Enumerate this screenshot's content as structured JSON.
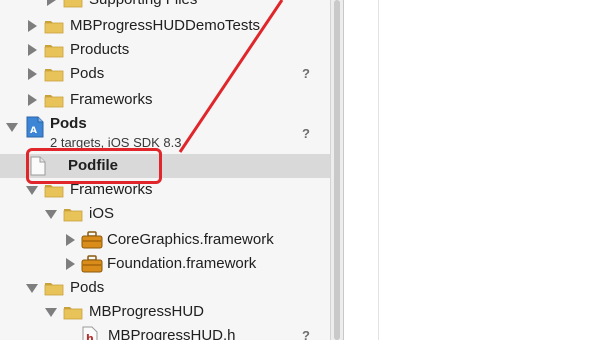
{
  "navigator": {
    "rows": [
      {
        "label": "Supporting Files",
        "icon": "folder-icon",
        "disclosure": "right",
        "indent": 1,
        "status": ""
      },
      {
        "label": "MBProgressHUDDemoTests",
        "icon": "folder-icon",
        "disclosure": "right",
        "indent": 0,
        "status": ""
      },
      {
        "label": "Products",
        "icon": "folder-icon",
        "disclosure": "right",
        "indent": 0,
        "status": ""
      },
      {
        "label": "Pods",
        "icon": "folder-icon",
        "disclosure": "right",
        "indent": 0,
        "status": "?"
      },
      {
        "label": "Frameworks",
        "icon": "folder-icon",
        "disclosure": "right",
        "indent": 0,
        "status": ""
      },
      {
        "label": "Pods",
        "sublabel": "2 targets, iOS SDK 8.3",
        "icon": "xcode-project-icon",
        "disclosure": "down",
        "indent": -1,
        "status": "?"
      },
      {
        "label": "Podfile",
        "icon": "file-icon",
        "disclosure": "none",
        "indent": 0,
        "status": "",
        "selected": true
      },
      {
        "label": "Frameworks",
        "icon": "folder-icon",
        "disclosure": "down",
        "indent": 0,
        "status": ""
      },
      {
        "label": "iOS",
        "icon": "folder-icon",
        "disclosure": "down",
        "indent": 1,
        "status": ""
      },
      {
        "label": "CoreGraphics.framework",
        "icon": "framework-toolbox-icon",
        "disclosure": "right",
        "indent": 2,
        "status": ""
      },
      {
        "label": "Foundation.framework",
        "icon": "framework-toolbox-icon",
        "disclosure": "right",
        "indent": 2,
        "status": ""
      },
      {
        "label": "Pods",
        "icon": "folder-icon",
        "disclosure": "down",
        "indent": 0,
        "status": ""
      },
      {
        "label": "MBProgressHUD",
        "icon": "folder-icon",
        "disclosure": "down",
        "indent": 1,
        "status": ""
      },
      {
        "label": "MBProgressHUD.h",
        "icon": "header-file-icon",
        "disclosure": "none",
        "indent": 2,
        "status": "?"
      }
    ]
  },
  "annotation": {
    "highlight_color": "#e0262a",
    "target": "Podfile"
  },
  "colors": {
    "folder": "#e8c35a",
    "folder_dark": "#c9a13b",
    "selection": "#d9d9d9",
    "toolbox": "#d98c1a"
  }
}
